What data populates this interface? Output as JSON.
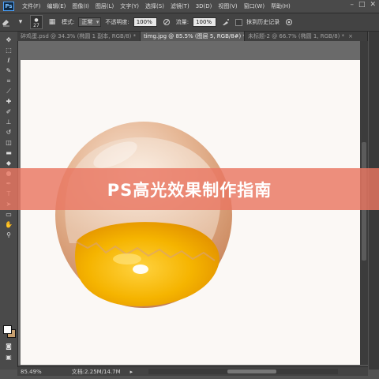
{
  "app": {
    "logo": "Ps"
  },
  "menu": [
    "文件(F)",
    "编辑(E)",
    "图像(I)",
    "图层(L)",
    "文字(Y)",
    "选择(S)",
    "滤镜(T)",
    "3D(D)",
    "视图(V)",
    "窗口(W)",
    "帮助(H)"
  ],
  "window_controls": {
    "minimize": "–",
    "maximize": "□",
    "close": "✕"
  },
  "options": {
    "brush_size": "27",
    "mode_label": "模式:",
    "mode_value": "正常",
    "opacity_label": "不透明度:",
    "opacity_value": "100%",
    "flow_label": "流量:",
    "flow_value": "100%",
    "history_label": "抹到历史记录"
  },
  "tabs": [
    {
      "label": "碎鸡蛋.psd @ 34.3% (椭圆 1 副本, RGB/8) *",
      "close": "×",
      "active": false
    },
    {
      "label": "timg.jpg @ 85.5% (图层 5, RGB/8#) *",
      "close": "×",
      "active": true
    },
    {
      "label": "未标题-2 @ 66.7% (椭圆 1, RGB/8) *",
      "close": "×",
      "active": false
    }
  ],
  "status": {
    "zoom": "85.49%",
    "doc_info": "文档:2.25M/14.7M",
    "arrow": "▸"
  },
  "banner": {
    "text": "PS高光效果制作指南"
  },
  "colors": {
    "foreground": "#ffffff",
    "background": "#c8a070",
    "banner": "#e97662",
    "yolk": "#f5b400",
    "shell": "#d9a07a"
  },
  "tools": [
    "move-icon",
    "marquee-icon",
    "lasso-icon",
    "quick-select-icon",
    "crop-icon",
    "eyedropper-icon",
    "healing-icon",
    "brush-icon",
    "clone-stamp-icon",
    "history-brush-icon",
    "eraser-icon",
    "gradient-icon",
    "blur-icon",
    "dodge-icon",
    "pen-icon",
    "type-icon",
    "path-select-icon",
    "shape-icon",
    "hand-icon",
    "zoom-icon"
  ]
}
